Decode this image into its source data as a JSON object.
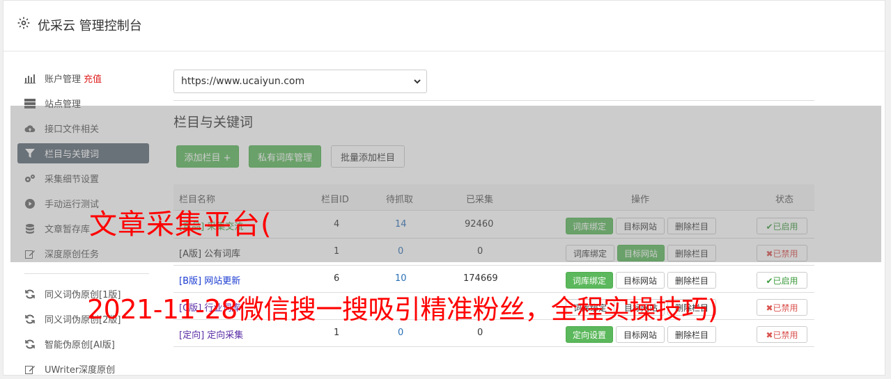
{
  "header": {
    "title": "优采云 管理控制台",
    "icon": "gear-icon"
  },
  "sidebar": {
    "items": [
      {
        "label": "账户管理",
        "badge": "充值",
        "icon": "bar-chart-icon"
      },
      {
        "label": "站点管理",
        "icon": "server-icon"
      },
      {
        "label": "接口文件相关",
        "icon": "cloud-upload-icon"
      },
      {
        "label": "栏目与关键词",
        "icon": "filter-icon",
        "active": true
      },
      {
        "label": "采集细节设置",
        "icon": "cogs-icon"
      },
      {
        "label": "手动运行测试",
        "icon": "play-circle-icon"
      },
      {
        "label": "文章暂存库",
        "icon": "database-icon"
      },
      {
        "label": "深度原创任务",
        "icon": "edit-icon"
      },
      {
        "label": "同义词伪原创[1版]",
        "icon": "refresh-icon"
      },
      {
        "label": "同义词伪原创[2版]",
        "icon": "refresh-icon"
      },
      {
        "label": "智能伪原创[AI版]",
        "icon": "refresh-icon"
      },
      {
        "label": "UWriter深度原创",
        "icon": "edit-icon"
      }
    ]
  },
  "site_select": {
    "value": "https://www.ucaiyun.com"
  },
  "section": {
    "title": "栏目与关键词",
    "add_column": "添加栏目 +",
    "private_lib": "私有词库管理",
    "batch_add": "批量添加栏目"
  },
  "table": {
    "headers": {
      "name": "栏目名称",
      "id": "栏目ID",
      "pending": "待抓取",
      "collected": "已采集",
      "ops": "操作",
      "status": "状态"
    },
    "rows": [
      {
        "name": "[竞品] 采集交流",
        "id": "4",
        "pending": "14",
        "collected": "92460",
        "op1": "词库绑定",
        "op2": "目标网站",
        "op3": "删除栏目",
        "status": "✔已启用",
        "enabled": true
      },
      {
        "name": "[A版] 公有词库",
        "id": "1",
        "pending": "0",
        "collected": "0",
        "op1": "词库绑定",
        "op2": "目标网站",
        "op3": "删除栏目",
        "status": "✖已禁用",
        "enabled": false
      },
      {
        "name": "[B版] 网站更新",
        "id": "6",
        "pending": "10",
        "collected": "174669",
        "op1": "词库绑定",
        "op2": "目标网站",
        "op3": "删除栏目",
        "status": "✔已启用",
        "enabled": true
      },
      {
        "name": "[C版] 行业词库",
        "id": "",
        "pending": "",
        "collected": "",
        "op1": "词库绑定",
        "op2": "目标网站",
        "op3": "删除栏目",
        "status": "✖已禁用",
        "enabled": false
      },
      {
        "name": "[定向] 定向采集",
        "id": "1",
        "pending": "0",
        "collected": "0",
        "op1": "定向设置",
        "op2": "目标网站",
        "op3": "删除栏目",
        "status": "✖已禁用",
        "enabled": false
      }
    ]
  },
  "watermark": {
    "line1": "文章采集平台(",
    "line2": "2021-11-28微信搜一搜吸引精准粉丝，全程实操技巧)"
  },
  "colors": {
    "accent_green": "#5cb85c",
    "sidebar_active": "#5c6975",
    "watermark": "#ff0000"
  }
}
